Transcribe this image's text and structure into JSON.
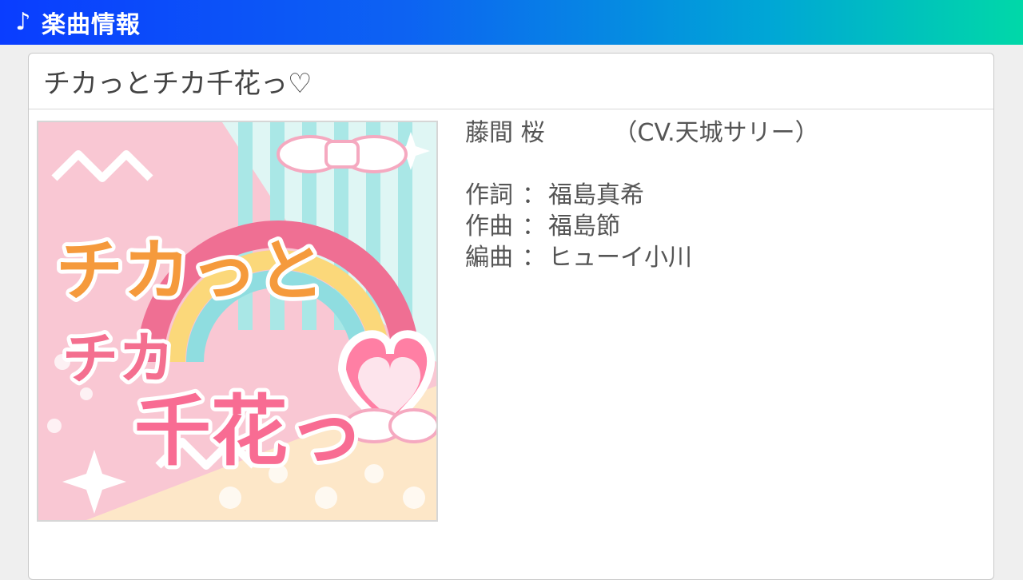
{
  "header": {
    "icon": "music-note-icon",
    "title": "楽曲情報"
  },
  "song": {
    "title": "チカっとチカ千花っ♡",
    "jacket_text_line1": "チカっと",
    "jacket_text_line2": "チカ",
    "jacket_text_line3": "千花っ"
  },
  "artist": {
    "name": "藤間 桜",
    "cv": "（CV.天城サリー）"
  },
  "credits": [
    {
      "label": "作詞",
      "sep": "：",
      "value": "福島真希"
    },
    {
      "label": "作曲",
      "sep": "：",
      "value": "福島節"
    },
    {
      "label": "編曲",
      "sep": "：",
      "value": "ヒューイ小川"
    }
  ],
  "colors": {
    "header_gradient_start": "#0a3dff",
    "header_gradient_end": "#00d8a8",
    "panel_bg": "#ffffff",
    "text": "#444444"
  }
}
